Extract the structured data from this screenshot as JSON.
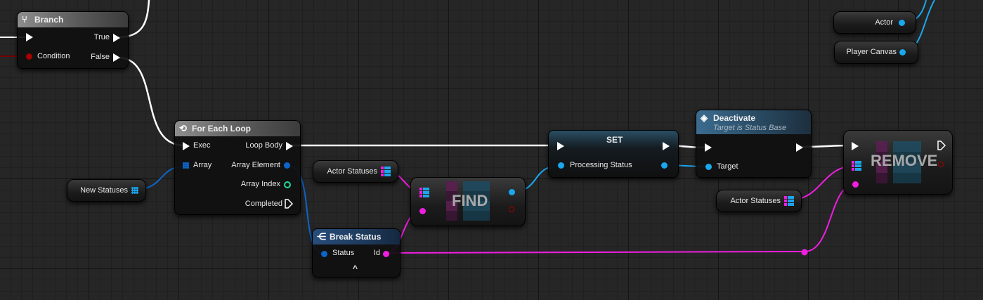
{
  "colors": {
    "exec": "#ffffff",
    "object": "#1ba7ee",
    "struct_status": "#0c65c9",
    "name_id": "#f01ee0",
    "int": "#1fd9a0",
    "bool": "#a50000"
  },
  "branch": {
    "title": "Branch",
    "true_label": "True",
    "condition_label": "Condition",
    "false_label": "False",
    "icon": "branch-icon"
  },
  "actor_var": {
    "label": "Actor"
  },
  "player_canvas_var": {
    "label": "Player Canvas"
  },
  "for_each": {
    "title": "For Each Loop",
    "icon": "loop-icon",
    "exec_label": "Exec",
    "loop_body_label": "Loop Body",
    "array_label": "Array",
    "array_element_label": "Array Element",
    "array_index_label": "Array Index",
    "completed_label": "Completed"
  },
  "new_statuses_var": {
    "label": "New Statuses"
  },
  "actor_statuses_var_1": {
    "label": "Actor Statuses"
  },
  "actor_statuses_var_2": {
    "label": "Actor Statuses"
  },
  "find_node": {
    "label": "FIND"
  },
  "set_node": {
    "title": "SET",
    "processing_status_label": "Processing Status"
  },
  "deactivate": {
    "title": "Deactivate",
    "subtitle": "Target is Status Base",
    "target_label": "Target",
    "icon": "function-icon"
  },
  "remove_node": {
    "label": "REMOVE"
  },
  "break_status": {
    "title": "Break Status",
    "status_label": "Status",
    "id_label": "Id",
    "expand_glyph": "^",
    "icon": "break-struct-icon"
  }
}
